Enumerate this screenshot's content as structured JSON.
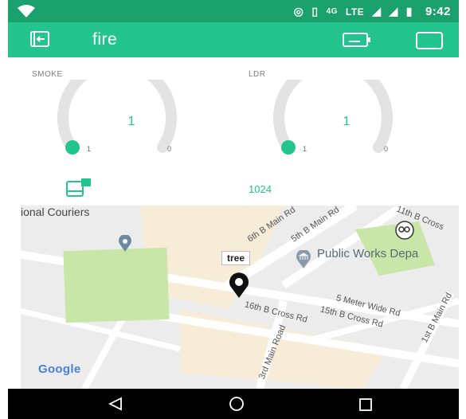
{
  "status_bar": {
    "network": "4G",
    "lte": "LTE",
    "time": "9:42"
  },
  "app_bar": {
    "title": "fire",
    "left_icon": "exit-icon",
    "right_icons": [
      "device-icon",
      "square-icon"
    ]
  },
  "widgets": {
    "smoke": {
      "label": "SMOKE",
      "value": "1",
      "min": "1",
      "max": "0",
      "level": 0.0
    },
    "ldr": {
      "label": "LDR",
      "value": "1",
      "min": "1",
      "max": "0",
      "level": 0.0
    },
    "value_display": "1024"
  },
  "map": {
    "top_left_text": "ional Couriers",
    "place_label": "Public Works Depa",
    "marker_label": "tree",
    "attribution": "Google",
    "streets": [
      "6th B Main Rd",
      "5th B Main Rd",
      "11th B Cross",
      "5 Meter Wide Rd",
      "15th B Cross Rd",
      "16th B Cross Rd",
      "1st B Main Rd",
      "3rd Main Road"
    ]
  },
  "nav_bar": {
    "back_icon": "back-triangle-icon",
    "home_icon": "home-circle-icon",
    "recents_icon": "recents-square-icon"
  },
  "colors": {
    "accent": "#23c48e",
    "status": "#1aa06c",
    "map_park": "#c8e6a8"
  }
}
